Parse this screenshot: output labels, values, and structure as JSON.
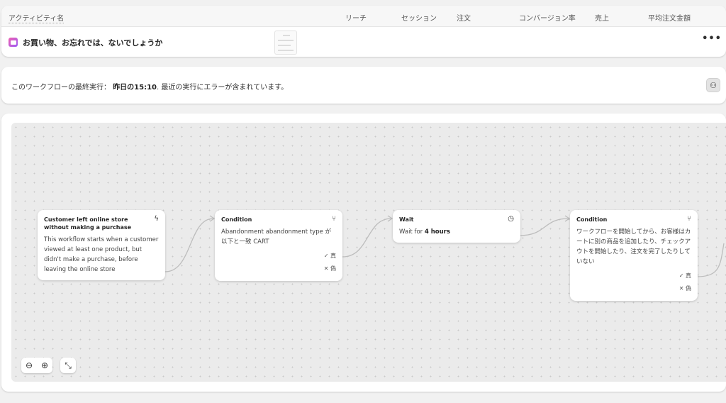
{
  "table": {
    "columns": [
      "アクティビティ名",
      "リーチ",
      "セッション",
      "注文",
      "コンバージョン率",
      "売上",
      "平均注文金額"
    ],
    "row": {
      "icon": "email-icon",
      "name": "お買い物、お忘れでは、ないでしょうか",
      "menu": "•••"
    }
  },
  "status": {
    "prefix": "このワークフローの最終実行：",
    "time": "昨日の15:10",
    "suffix": ". 最近の実行にエラーが含まれています。",
    "button_icon": "workflow-icon"
  },
  "nodes": [
    {
      "title": "Customer left online store without making a purchase",
      "icon": "lightning-icon",
      "body": "This workflow starts when a customer viewed at least one product, but didn't make a purchase, before leaving the online store"
    },
    {
      "title": "Condition",
      "icon": "branch-icon",
      "body": "Abandonment abandonment type が以下と一致 CART",
      "true": "真",
      "false": "偽"
    },
    {
      "title": "Wait",
      "icon": "clock-icon",
      "body_prefix": "Wait for ",
      "body_bold": "4 hours"
    },
    {
      "title": "Condition",
      "icon": "branch-icon",
      "body": "ワークフローを開始してから、お客様はカートに別の商品を追加したり、チェックアウトを開始したり、注文を完了したりしていない",
      "true": "真",
      "false": "偽"
    }
  ],
  "controls": {
    "zoom_out": "zoom-out-icon",
    "zoom_in": "zoom-in-icon",
    "fit": "fit-view-icon"
  }
}
